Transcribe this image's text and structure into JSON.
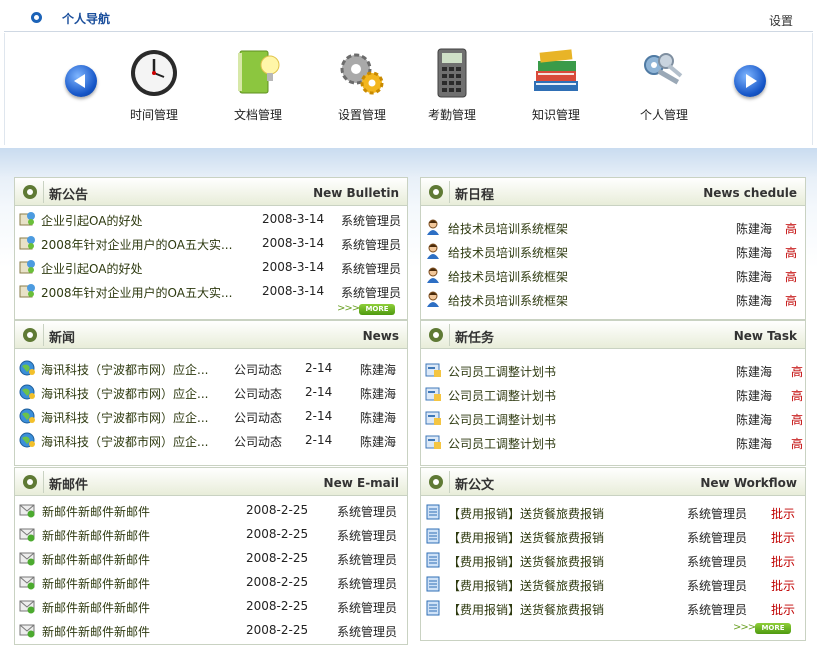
{
  "header": {
    "title": "个人导航",
    "settings": "设置"
  },
  "nav": {
    "items": [
      {
        "label": "时间管理",
        "icon": "clock-icon"
      },
      {
        "label": "文档管理",
        "icon": "document-icon"
      },
      {
        "label": "设置管理",
        "icon": "gears-icon"
      },
      {
        "label": "考勤管理",
        "icon": "calculator-icon"
      },
      {
        "label": "知识管理",
        "icon": "books-icon"
      },
      {
        "label": "个人管理",
        "icon": "keys-icon"
      }
    ]
  },
  "bulletin": {
    "title_cn": "新公告",
    "title_en": "New Bulletin",
    "more": "MORE",
    "rows": [
      {
        "title": "企业引起OA的好处",
        "date": "2008-3-14",
        "author": "系统管理员"
      },
      {
        "title": "2008年针对企业用户的OA五大实...",
        "date": "2008-3-14",
        "author": "系统管理员"
      },
      {
        "title": "企业引起OA的好处",
        "date": "2008-3-14",
        "author": "系统管理员"
      },
      {
        "title": "2008年针对企业用户的OA五大实...",
        "date": "2008-3-14",
        "author": "系统管理员"
      }
    ]
  },
  "schedule": {
    "title_cn": "新日程",
    "title_en": "News chedule",
    "rows": [
      {
        "title": "给技术员培训系统框架",
        "person": "陈建海",
        "level": "高"
      },
      {
        "title": "给技术员培训系统框架",
        "person": "陈建海",
        "level": "高"
      },
      {
        "title": "给技术员培训系统框架",
        "person": "陈建海",
        "level": "高"
      },
      {
        "title": "给技术员培训系统框架",
        "person": "陈建海",
        "level": "高"
      }
    ]
  },
  "news": {
    "title_cn": "新闻",
    "title_en": "News",
    "rows": [
      {
        "title": "海讯科技（宁波都市网）应企...",
        "category": "公司动态",
        "date": "2-14",
        "person": "陈建海"
      },
      {
        "title": "海讯科技（宁波都市网）应企...",
        "category": "公司动态",
        "date": "2-14",
        "person": "陈建海"
      },
      {
        "title": "海讯科技（宁波都市网）应企...",
        "category": "公司动态",
        "date": "2-14",
        "person": "陈建海"
      },
      {
        "title": "海讯科技（宁波都市网）应企...",
        "category": "公司动态",
        "date": "2-14",
        "person": "陈建海"
      }
    ]
  },
  "task": {
    "title_cn": "新任务",
    "title_en": "New Task",
    "rows": [
      {
        "title": "公司员工调整计划书",
        "person": "陈建海",
        "level": "高"
      },
      {
        "title": "公司员工调整计划书",
        "person": "陈建海",
        "level": "高"
      },
      {
        "title": "公司员工调整计划书",
        "person": "陈建海",
        "level": "高"
      },
      {
        "title": "公司员工调整计划书",
        "person": "陈建海",
        "level": "高"
      }
    ]
  },
  "email": {
    "title_cn": "新邮件",
    "title_en": "New E-mail",
    "rows": [
      {
        "title": "新邮件新邮件新邮件",
        "date": "2008-2-25",
        "sender": "系统管理员"
      },
      {
        "title": "新邮件新邮件新邮件",
        "date": "2008-2-25",
        "sender": "系统管理员"
      },
      {
        "title": "新邮件新邮件新邮件",
        "date": "2008-2-25",
        "sender": "系统管理员"
      },
      {
        "title": "新邮件新邮件新邮件",
        "date": "2008-2-25",
        "sender": "系统管理员"
      },
      {
        "title": "新邮件新邮件新邮件",
        "date": "2008-2-25",
        "sender": "系统管理员"
      },
      {
        "title": "新邮件新邮件新邮件",
        "date": "2008-2-25",
        "sender": "系统管理员"
      }
    ]
  },
  "workflow": {
    "title_cn": "新公文",
    "title_en": "New Workflow",
    "more": "MORE",
    "rows": [
      {
        "title": "【费用报销】送货餐旅费报销",
        "person": "系统管理员",
        "action": "批示"
      },
      {
        "title": "【费用报销】送货餐旅费报销",
        "person": "系统管理员",
        "action": "批示"
      },
      {
        "title": "【费用报销】送货餐旅费报销",
        "person": "系统管理员",
        "action": "批示"
      },
      {
        "title": "【费用报销】送货餐旅费报销",
        "person": "系统管理员",
        "action": "批示"
      },
      {
        "title": "【费用报销】送货餐旅费报销",
        "person": "系统管理员",
        "action": "批示"
      }
    ]
  },
  "colors": {
    "link": "#2e3a10",
    "priority": "#c00000",
    "header_blue": "#1b4f9c",
    "panel_green": "#5f7a35"
  }
}
